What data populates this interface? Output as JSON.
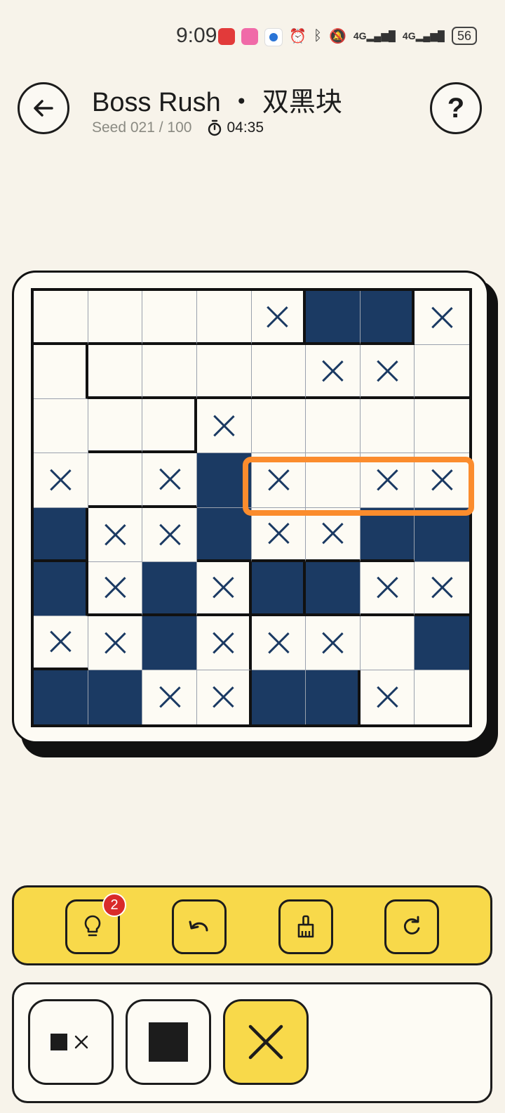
{
  "status": {
    "time": "9:09",
    "network_1": "4G",
    "network_2": "4G",
    "battery": "56"
  },
  "header": {
    "title": "Boss Rush ・ 双黑块",
    "seed": "Seed 021 / 100",
    "timer": "04:35",
    "help": "?"
  },
  "board": {
    "rows": 8,
    "cols": 8,
    "legend": "F = filled, X = crossed, . = empty",
    "cells": [
      "....XFFX",
      ".....XX.",
      "...X....",
      "X.XFX.XX",
      "FXXFXXFF",
      "FXFXFFXX",
      "XXFXXX.F",
      "FFXXFFX."
    ],
    "highlighted_row": 3,
    "highlighted_cols": [
      4,
      7
    ]
  },
  "toolbar": {
    "hint_count": "2",
    "tools": [
      "hint-button",
      "undo-button",
      "clear-button",
      "restart-button"
    ]
  },
  "modes": {
    "selected": "cross",
    "options": [
      "auto",
      "fill",
      "cross"
    ]
  },
  "colors": {
    "background": "#f7f3ea",
    "filled_cell": "#1b3a63",
    "highlight": "#fb8c2d",
    "toolbar": "#f8d94a",
    "badge": "#d92a2a"
  }
}
